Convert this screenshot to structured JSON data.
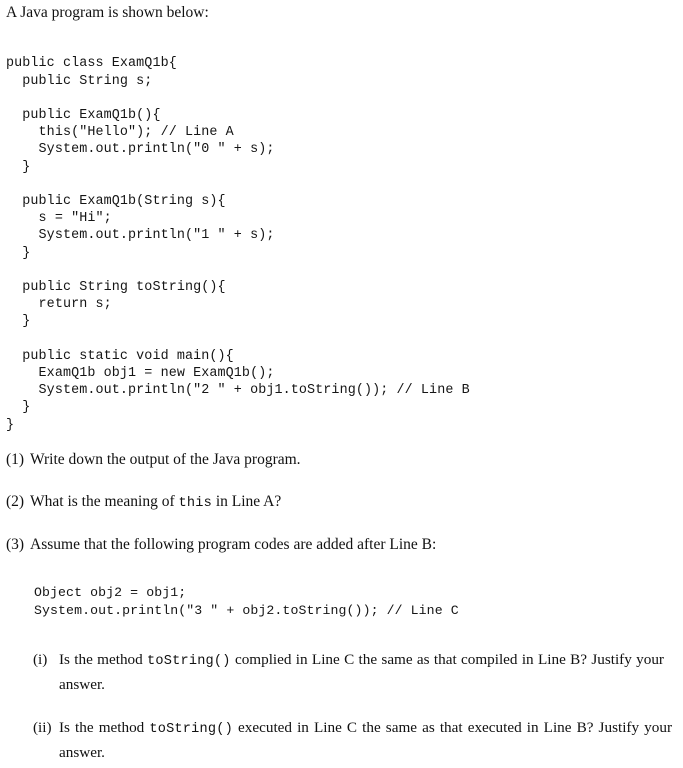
{
  "document": {
    "intro": "A Java program is shown below:",
    "program_code": "public class ExamQ1b{\n  public String s;\n\n  public ExamQ1b(){\n    this(\"Hello\"); // Line A\n    System.out.println(\"0 \" + s);\n  }\n\n  public ExamQ1b(String s){\n    s = \"Hi\";\n    System.out.println(\"1 \" + s);\n  }\n\n  public String toString(){\n    return s;\n  }\n\n  public static void main(){\n    ExamQ1b obj1 = new ExamQ1b();\n    System.out.println(\"2 \" + obj1.toString()); // Line B\n  }\n}",
    "added_code": "Object obj2 = obj1;\nSystem.out.println(\"3 \" + obj2.toString()); // Line C",
    "questions": [
      {
        "marker": "(1)",
        "text": "Write down the output of the Java program."
      },
      {
        "marker": "(2)",
        "text_before": "What is the meaning of ",
        "code": "this",
        "text_after": " in Line A?"
      },
      {
        "marker": "(3)",
        "text": "Assume that the following program codes are added after Line B:"
      }
    ],
    "sub_questions": [
      {
        "marker": "(i)",
        "text_before": "Is the method ",
        "code": "toString()",
        "text_after": " complied in Line C the same as that compiled in Line B? Justify your answer."
      },
      {
        "marker": "(ii)",
        "text_before": "Is the method ",
        "code": "toString()",
        "text_after": " executed in Line C the same as that executed in Line B? Justify your answer."
      }
    ]
  },
  "colors": {
    "background": "#ffffff",
    "text": "#111111"
  }
}
